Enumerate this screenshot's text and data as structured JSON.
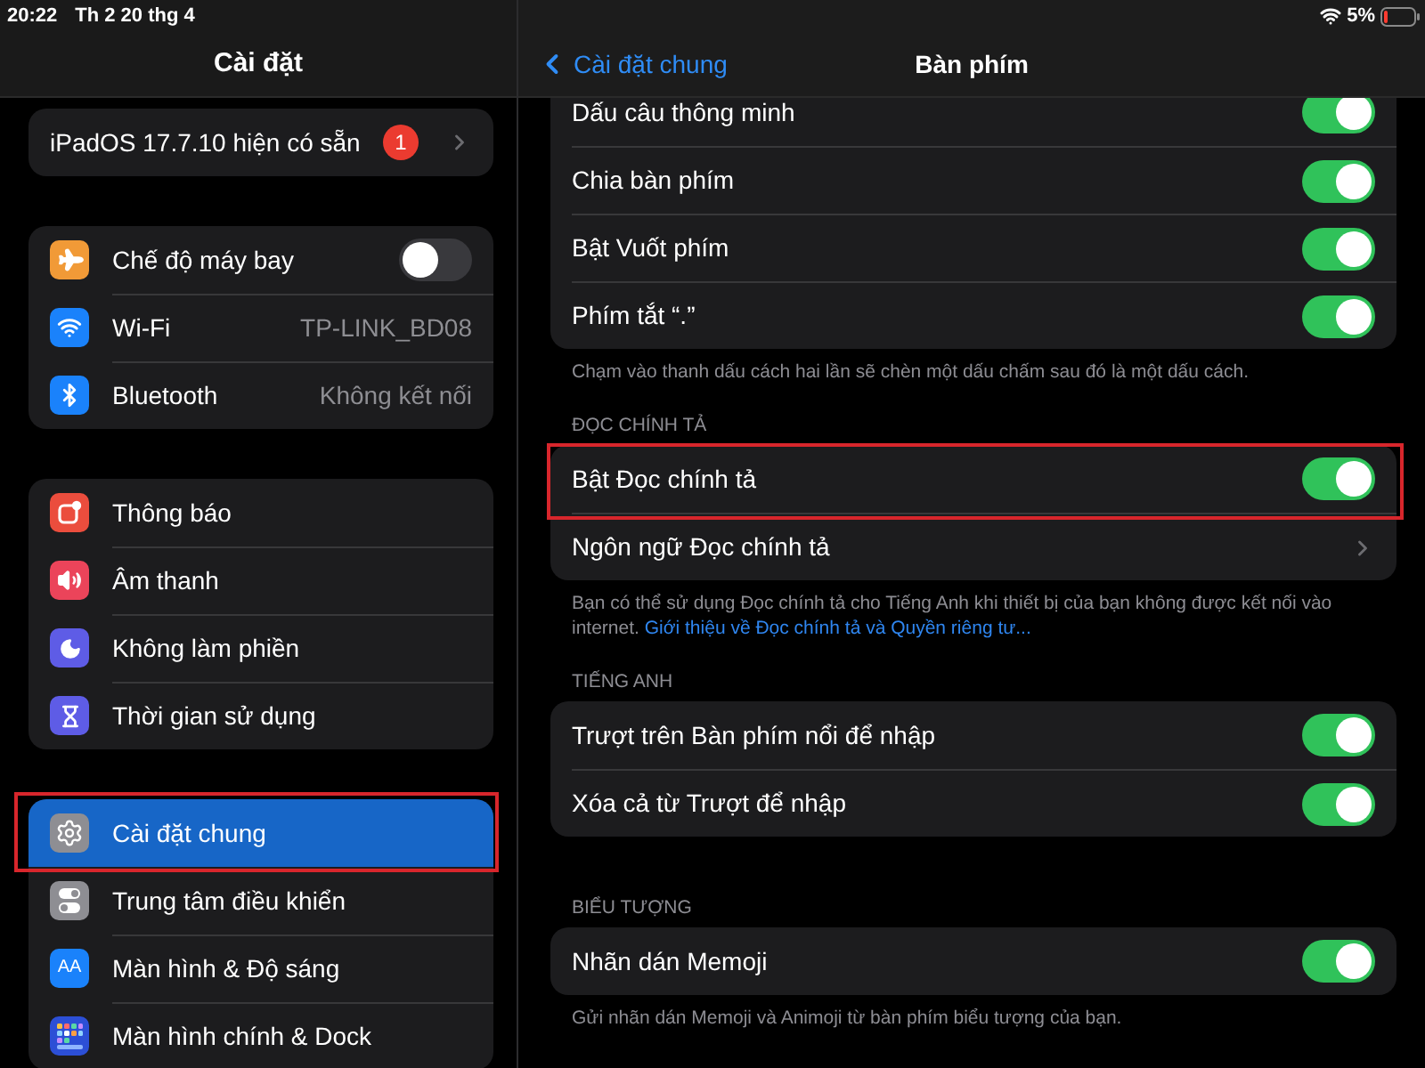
{
  "status_bar": {
    "time": "20:22",
    "date": "Th 2 20 thg 4",
    "battery": "5%"
  },
  "sidebar": {
    "title": "Cài đặt",
    "groups": [
      {
        "items": [
          {
            "kind": "update",
            "label": "iPadOS 17.7.10 hiện có sẵn",
            "badge": "1",
            "selected": false,
            "highlighted": false
          }
        ]
      },
      {
        "items": [
          {
            "kind": "toggle",
            "label": "Chế độ máy bay",
            "on": false,
            "selected": false,
            "highlighted": false
          },
          {
            "kind": "value",
            "label": "Wi-Fi",
            "value": "TP-LINK_BD08",
            "selected": false,
            "highlighted": false
          },
          {
            "kind": "value",
            "label": "Bluetooth",
            "value": "Không kết nối",
            "selected": false,
            "highlighted": false
          }
        ]
      },
      {
        "items": [
          {
            "kind": "plain",
            "label": "Thông báo",
            "selected": false,
            "highlighted": false
          },
          {
            "kind": "plain",
            "label": "Âm thanh",
            "selected": false,
            "highlighted": false
          },
          {
            "kind": "plain",
            "label": "Không làm phiền",
            "selected": false,
            "highlighted": false
          },
          {
            "kind": "plain",
            "label": "Thời gian sử dụng",
            "selected": false,
            "highlighted": false
          }
        ]
      },
      {
        "items": [
          {
            "kind": "plain",
            "label": "Cài đặt chung",
            "selected": true,
            "highlighted": true
          },
          {
            "kind": "plain",
            "label": "Trung tâm điều khiển",
            "selected": false,
            "highlighted": false
          },
          {
            "kind": "plain",
            "label": "Màn hình & Độ sáng",
            "icon_text": "AA",
            "selected": false,
            "highlighted": false
          },
          {
            "kind": "plain",
            "label": "Màn hình chính & Dock",
            "selected": false,
            "highlighted": false
          }
        ]
      }
    ]
  },
  "detail": {
    "back": "Cài đặt chung",
    "title": "Bàn phím",
    "sections": [
      {
        "rows": [
          {
            "kind": "toggle",
            "label": "Dấu câu thông minh",
            "on": true,
            "highlighted": false
          },
          {
            "kind": "toggle",
            "label": "Chia bàn phím",
            "on": true,
            "highlighted": false
          },
          {
            "kind": "toggle",
            "label": "Bật Vuốt phím",
            "on": true,
            "highlighted": false
          },
          {
            "kind": "toggle",
            "label": "Phím tắt “.”",
            "on": true,
            "highlighted": false
          }
        ],
        "footer": "Chạm vào thanh dấu cách hai lần sẽ chèn một dấu chấm sau đó là một dấu cách."
      },
      {
        "header": "ĐỌC CHÍNH TẢ",
        "rows": [
          {
            "kind": "toggle",
            "label": "Bật Đọc chính tả",
            "on": true,
            "highlighted": true
          },
          {
            "kind": "link",
            "label": "Ngôn ngữ Đọc chính tả",
            "highlighted": false
          }
        ],
        "footer": "Bạn có thể sử dụng Đọc chính tả cho Tiếng Anh khi thiết bị của bạn không được kết nối vào internet.",
        "footer_link": "Giới thiệu về Đọc chính tả và Quyền riêng tư..."
      },
      {
        "header": "TIẾNG ANH",
        "rows": [
          {
            "kind": "toggle",
            "label": "Trượt trên Bàn phím nổi để nhập",
            "on": true,
            "highlighted": false
          },
          {
            "kind": "toggle",
            "label": "Xóa cả từ Trượt để nhập",
            "on": true,
            "highlighted": false
          }
        ]
      },
      {
        "header": "BIỂU TƯỢNG",
        "rows": [
          {
            "kind": "toggle",
            "label": "Nhãn dán Memoji",
            "on": true,
            "highlighted": false
          }
        ],
        "footer": "Gửi nhãn dán Memoji và Animoji từ bàn phím biểu tượng của bạn."
      }
    ]
  }
}
